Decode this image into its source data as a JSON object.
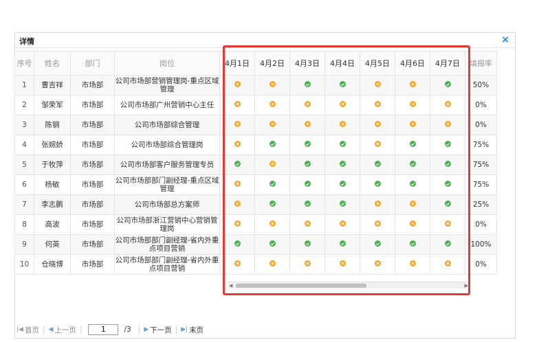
{
  "dialog": {
    "title": "详情",
    "close": "×"
  },
  "columns": {
    "index": "序号",
    "name": "姓名",
    "dept": "部门",
    "position": "岗位",
    "dates": [
      "4月1日",
      "4月2日",
      "4月3日",
      "4月4日",
      "4月5日",
      "4月6日",
      "4月7日"
    ],
    "rate": "填报率"
  },
  "rows": [
    {
      "index": "1",
      "name": "曹吉祥",
      "dept": "市场部",
      "position": "公司市场部营销管理岗-重点区域管理",
      "status": [
        "o",
        "o",
        "g",
        "g",
        "o",
        "o",
        "g"
      ],
      "rate": "50%"
    },
    {
      "index": "2",
      "name": "邹荣军",
      "dept": "市场部",
      "position": "公司市场部广州营销中心主任",
      "status": [
        "o",
        "o",
        "o",
        "o",
        "o",
        "o",
        "o"
      ],
      "rate": "0%"
    },
    {
      "index": "3",
      "name": "陈钢",
      "dept": "市场部",
      "position": "公司市场部综合管理",
      "status": [
        "o",
        "o",
        "o",
        "o",
        "o",
        "o",
        "o"
      ],
      "rate": "0%"
    },
    {
      "index": "4",
      "name": "张婉娇",
      "dept": "市场部",
      "position": "公司市场部综合管理岗",
      "status": [
        "o",
        "g",
        "g",
        "g",
        "o",
        "g",
        "g"
      ],
      "rate": "75%"
    },
    {
      "index": "5",
      "name": "于牧萍",
      "dept": "市场部",
      "position": "公司市场部客户服务管理专员",
      "status": [
        "g",
        "o",
        "g",
        "g",
        "g",
        "g",
        "g"
      ],
      "rate": "75%"
    },
    {
      "index": "6",
      "name": "杨敏",
      "dept": "市场部",
      "position": "公司市场部部门副经理-重点区域管理",
      "status": [
        "o",
        "g",
        "g",
        "g",
        "g",
        "g",
        "g"
      ],
      "rate": "75%"
    },
    {
      "index": "7",
      "name": "李志鹏",
      "dept": "市场部",
      "position": "公司市场部总方案师",
      "status": [
        "o",
        "g",
        "g",
        "g",
        "o",
        "o",
        "g"
      ],
      "rate": "25%"
    },
    {
      "index": "8",
      "name": "高波",
      "dept": "市场部",
      "position": "公司市场部浙江营销中心营销管理岗",
      "status": [
        "o",
        "o",
        "o",
        "o",
        "o",
        "o",
        "o"
      ],
      "rate": "0%"
    },
    {
      "index": "9",
      "name": "何英",
      "dept": "市场部",
      "position": "公司市场部部门副经理-省内外重点项目营销",
      "status": [
        "g",
        "g",
        "g",
        "g",
        "g",
        "g",
        "g"
      ],
      "rate": "100%"
    },
    {
      "index": "10",
      "name": "仓晓博",
      "dept": "市场部",
      "position": "公司市场部部门副经理-省内外重点项目营销",
      "status": [
        "o",
        "o",
        "o",
        "o",
        "o",
        "o",
        "o"
      ],
      "rate": "0%"
    }
  ],
  "pager": {
    "first": "首页",
    "prev": "上一页",
    "page_value": "1",
    "total": "/3",
    "next": "下一页",
    "last": "末页"
  },
  "colors": {
    "highlight": "#e53935",
    "ok": "#4caf50",
    "missing": "#f5a623",
    "link": "#1e88e5"
  }
}
